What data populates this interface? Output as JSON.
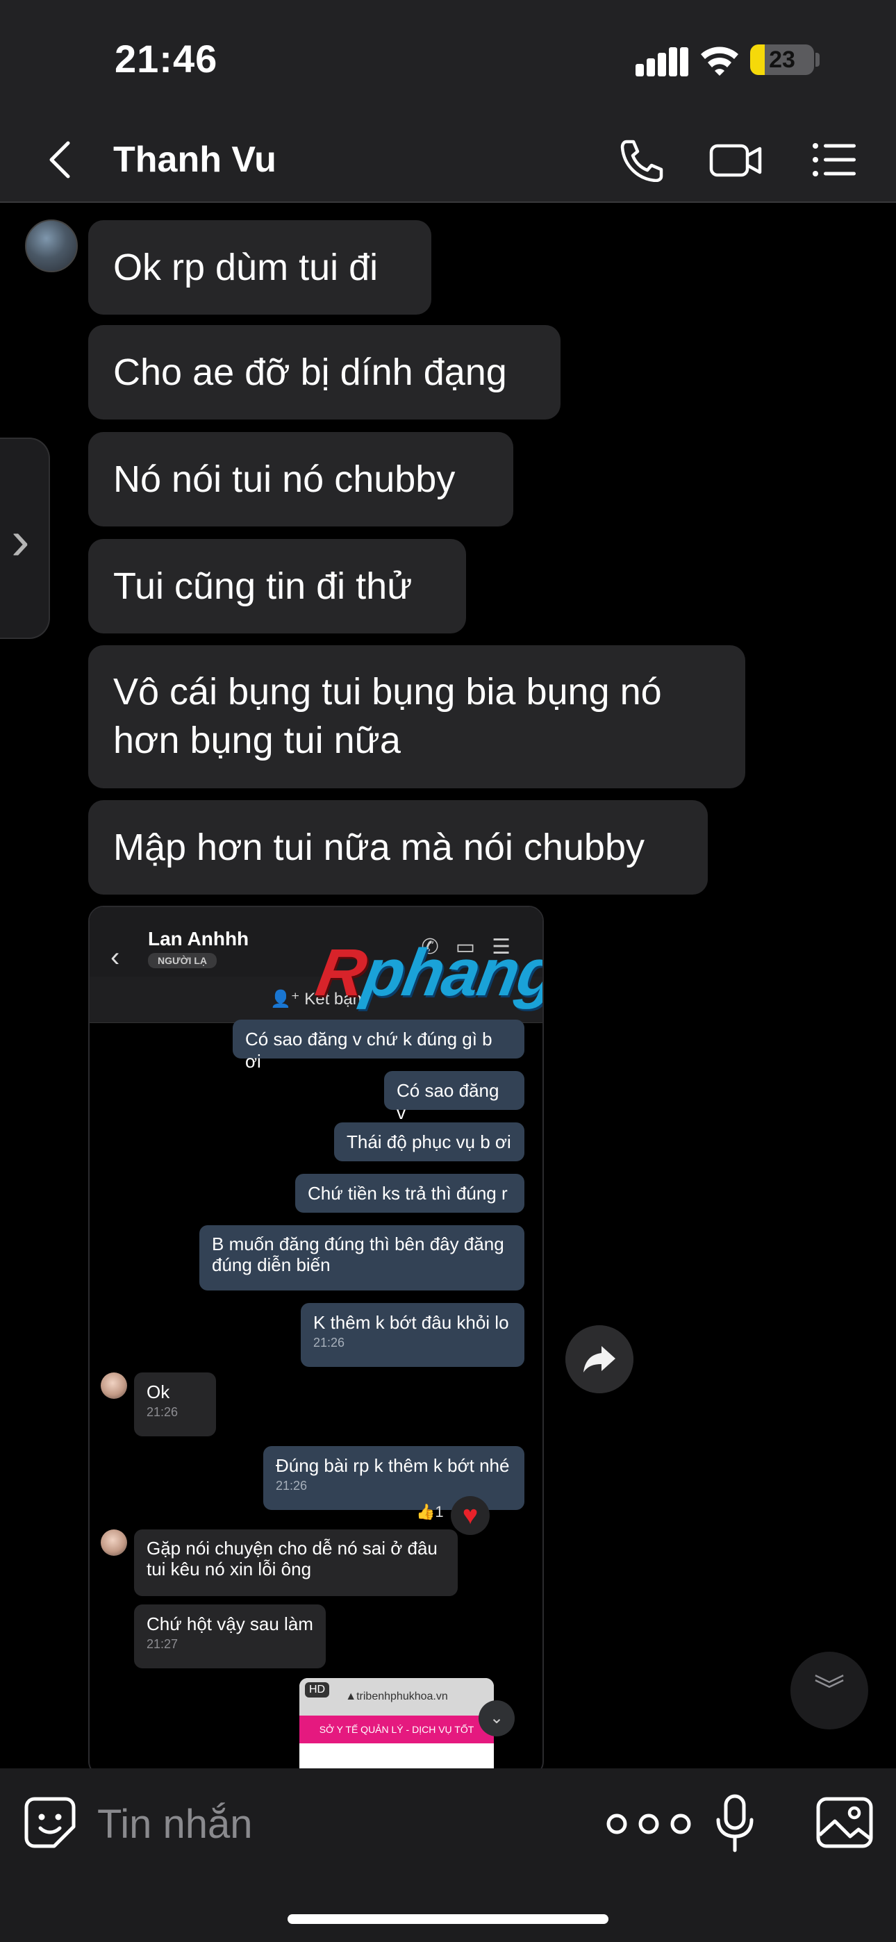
{
  "status": {
    "time": "21:46",
    "battery": "23",
    "battery_level": 0.23
  },
  "header": {
    "contact_name": "Thanh Vu"
  },
  "messages": [
    "Ok rp dùm tui đi",
    "Cho ae đỡ bị dính đạng",
    "Nó nói tui nó chubby",
    "Tui cũng tin đi thử",
    "Vô cái bụng tui bụng bia bụng nó hơn bụng tui nữa",
    "Mập hơn tui nữa mà nói chubby"
  ],
  "embedded": {
    "contact_name": "Lan Anhhh",
    "badge": "NGƯỜI LẠ",
    "add_friend": "Kết bạn",
    "watermark_r": "R",
    "watermark_rest": "phang",
    "out_msgs": [
      "Có sao đăng v chứ k đúng gì b ơi",
      "Có sao đăng v",
      "Thái độ phục vụ b ơi",
      "Chứ tiền ks trả thì đúng r",
      "B muốn đăng đúng thì bên đây đăng đúng diễn biến"
    ],
    "out_timed": {
      "text": "K thêm k bớt đâu khỏi lo",
      "time": "21:26"
    },
    "in_ok": {
      "text": "Ok",
      "time": "21:26"
    },
    "out_rp": {
      "text": "Đúng bài rp k thêm k bớt nhé",
      "time": "21:26"
    },
    "reaction_count": "1",
    "in_msg1": "Gặp nói chuyện cho dễ nó sai ở đâu tui kêu nó xin lỗi ông",
    "in_msg2": {
      "text": "Chứ hột vậy sau làm",
      "time": "21:27"
    },
    "preview": {
      "hd": "HD",
      "url": "tribenhphukhoa.vn",
      "banner": "SỞ Y TẾ QUẢN LÝ - DỊCH VỤ TỐT"
    }
  },
  "composer": {
    "placeholder": "Tin nhắn"
  },
  "icons": {
    "back": "chevron-left-icon",
    "call": "phone-icon",
    "video": "video-camera-icon",
    "menu": "list-icon",
    "share": "share-arrow-icon",
    "scroll": "double-chevron-down-icon",
    "emoji": "sticker-face-icon",
    "more": "ellipsis-icon",
    "mic": "microphone-icon",
    "image": "image-icon"
  }
}
